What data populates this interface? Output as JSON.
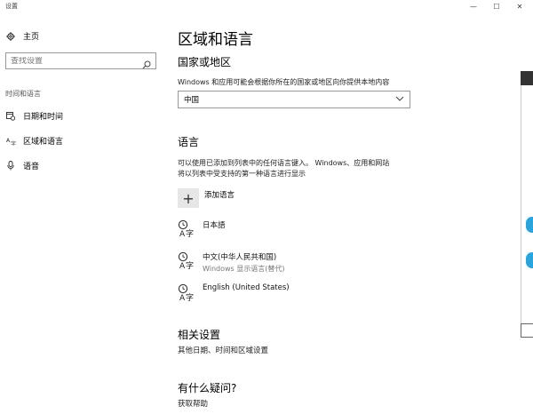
{
  "window": {
    "title": "设置",
    "controls": {
      "minimize": "—",
      "maximize": "☐",
      "close": "✕"
    }
  },
  "sidebar": {
    "home_label": "主页",
    "search_placeholder": "查找设置",
    "section_label": "时间和语言",
    "items": [
      {
        "label": "日期和时间",
        "icon": "calendar-clock-icon"
      },
      {
        "label": "区域和语言",
        "icon": "region-language-icon"
      },
      {
        "label": "语音",
        "icon": "microphone-icon"
      }
    ]
  },
  "main": {
    "title": "区域和语言",
    "region": {
      "heading": "国家或地区",
      "description": "Windows 和应用可能会根据你所在的国家或地区向你提供本地内容",
      "selected_country": "中国"
    },
    "language": {
      "heading": "语言",
      "description_line1": "可以使用已添加到列表中的任何语言键入。 Windows、应用和网站",
      "description_line2": "将以列表中受支持的第一种语言进行显示",
      "add_label": "添加语言",
      "items": [
        {
          "name": "日本語",
          "sub": ""
        },
        {
          "name": "中文(中华人民共和国)",
          "sub": "Windows 显示语言(替代)"
        },
        {
          "name": "English (United States)",
          "sub": ""
        }
      ]
    },
    "related": {
      "heading": "相关设置",
      "link": "其他日期、时间和区域设置"
    },
    "help": {
      "heading": "有什么疑问?",
      "link": "获取帮助"
    }
  },
  "colors": {
    "accent": "#2aa4dd",
    "border": "#999999",
    "button_bg": "#e6e6e6"
  }
}
